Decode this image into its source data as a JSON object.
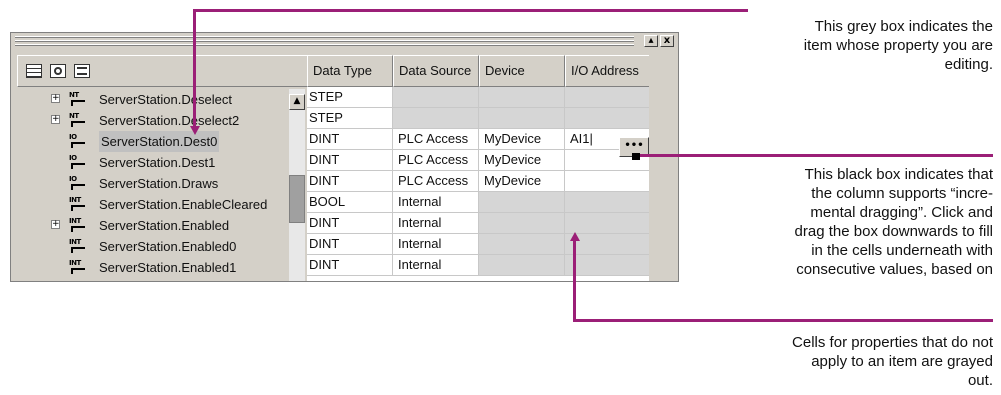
{
  "toolbar": {
    "restore_label": "▴",
    "close_label": "x"
  },
  "grid_headers": [
    "Data Type",
    "Data Source",
    "Device",
    "I/O Address"
  ],
  "rows": [
    {
      "name": "ServerStation.Deselect",
      "expander": "+",
      "icon": "NT",
      "data_type": "STEP",
      "data_source": "",
      "device": "",
      "io_address": ""
    },
    {
      "name": "ServerStation.Deselect2",
      "expander": "+",
      "icon": "NT",
      "data_type": "STEP",
      "data_source": "",
      "device": "",
      "io_address": ""
    },
    {
      "name": "ServerStation.Dest0",
      "expander": "",
      "icon": "IO",
      "data_type": "DINT",
      "data_source": "PLC Access",
      "device": "MyDevice",
      "io_address": "AI1|",
      "selected": true
    },
    {
      "name": "ServerStation.Dest1",
      "expander": "",
      "icon": "IO",
      "data_type": "DINT",
      "data_source": "PLC Access",
      "device": "MyDevice",
      "io_address": ""
    },
    {
      "name": "ServerStation.Draws",
      "expander": "",
      "icon": "IO",
      "data_type": "DINT",
      "data_source": "PLC Access",
      "device": "MyDevice",
      "io_address": ""
    },
    {
      "name": "ServerStation.EnableCleared",
      "expander": "",
      "icon": "INT",
      "data_type": "BOOL",
      "data_source": "Internal",
      "device": "",
      "io_address": ""
    },
    {
      "name": "ServerStation.Enabled",
      "expander": "+",
      "icon": "INT",
      "data_type": "DINT",
      "data_source": "Internal",
      "device": "",
      "io_address": ""
    },
    {
      "name": "ServerStation.Enabled0",
      "expander": "",
      "icon": "INT",
      "data_type": "DINT",
      "data_source": "Internal",
      "device": "",
      "io_address": ""
    },
    {
      "name": "ServerStation.Enabled1",
      "expander": "",
      "icon": "INT",
      "data_type": "DINT",
      "data_source": "Internal",
      "device": "",
      "io_address": ""
    }
  ],
  "ellipsis_label": "•••",
  "scroll_up_label": "▲",
  "callouts": {
    "grey_box": [
      "This grey box indicates the",
      "item whose property you are",
      "editing."
    ],
    "black_box": [
      "This black box indicates that",
      "the column supports “incre-",
      "mental dragging”. Click and",
      "drag the box downwards to fill",
      "in the cells underneath with",
      "consecutive values, based on"
    ],
    "grayed": [
      "Cells for properties that do not",
      "apply to an item are grayed",
      "out."
    ]
  },
  "colors": {
    "callout_line": "#9b1f77",
    "grayed_cell": "#d6d6d6",
    "window_face": "#d4d0c8"
  }
}
